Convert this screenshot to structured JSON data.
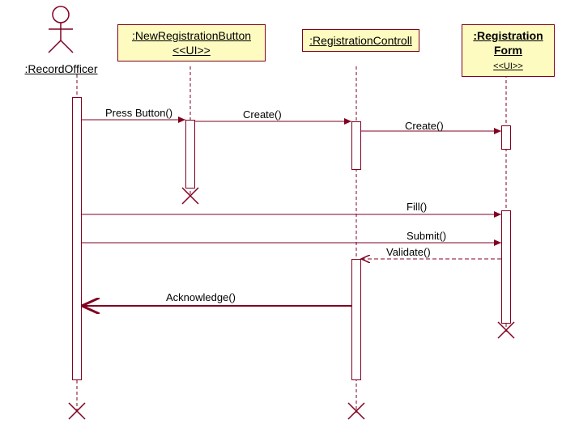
{
  "actor": {
    "label": ":RecordOfficer"
  },
  "lifelines": {
    "newRegBtn": {
      "title": ":NewRegistrationButton  <<UI>>"
    },
    "regControl": {
      "title": ":RegistrationControll"
    },
    "regForm": {
      "title": ":Registration Form",
      "stereo": "<<UI>>"
    }
  },
  "messages": {
    "press": "Press Button()",
    "create1": "Create()",
    "create2": "Create()",
    "fill": "Fill()",
    "submit": "Submit()",
    "validate": "Validate()",
    "ack": "Acknowledge()"
  },
  "chart_data": {
    "type": "sequence_diagram",
    "lifelines": [
      {
        "id": "actor",
        "name": ":RecordOfficer",
        "stereotype": "actor"
      },
      {
        "id": "btn",
        "name": ":NewRegistrationButton",
        "stereotype": "<<UI>>"
      },
      {
        "id": "ctrl",
        "name": ":RegistrationControll",
        "stereotype": ""
      },
      {
        "id": "form",
        "name": ":Registration Form",
        "stereotype": "<<UI>>"
      }
    ],
    "messages": [
      {
        "from": "actor",
        "to": "btn",
        "label": "Press Button()",
        "kind": "sync"
      },
      {
        "from": "btn",
        "to": "ctrl",
        "label": "Create()",
        "kind": "create"
      },
      {
        "from": "ctrl",
        "to": "form",
        "label": "Create()",
        "kind": "create"
      },
      {
        "from": "actor",
        "to": "form",
        "label": "Fill()",
        "kind": "sync"
      },
      {
        "from": "actor",
        "to": "form",
        "label": "Submit()",
        "kind": "sync"
      },
      {
        "from": "form",
        "to": "ctrl",
        "label": "Validate()",
        "kind": "sync"
      },
      {
        "from": "ctrl",
        "to": "actor",
        "label": "Acknowledge()",
        "kind": "return"
      }
    ],
    "destroyed": [
      "btn",
      "ctrl",
      "form",
      "actor"
    ]
  }
}
